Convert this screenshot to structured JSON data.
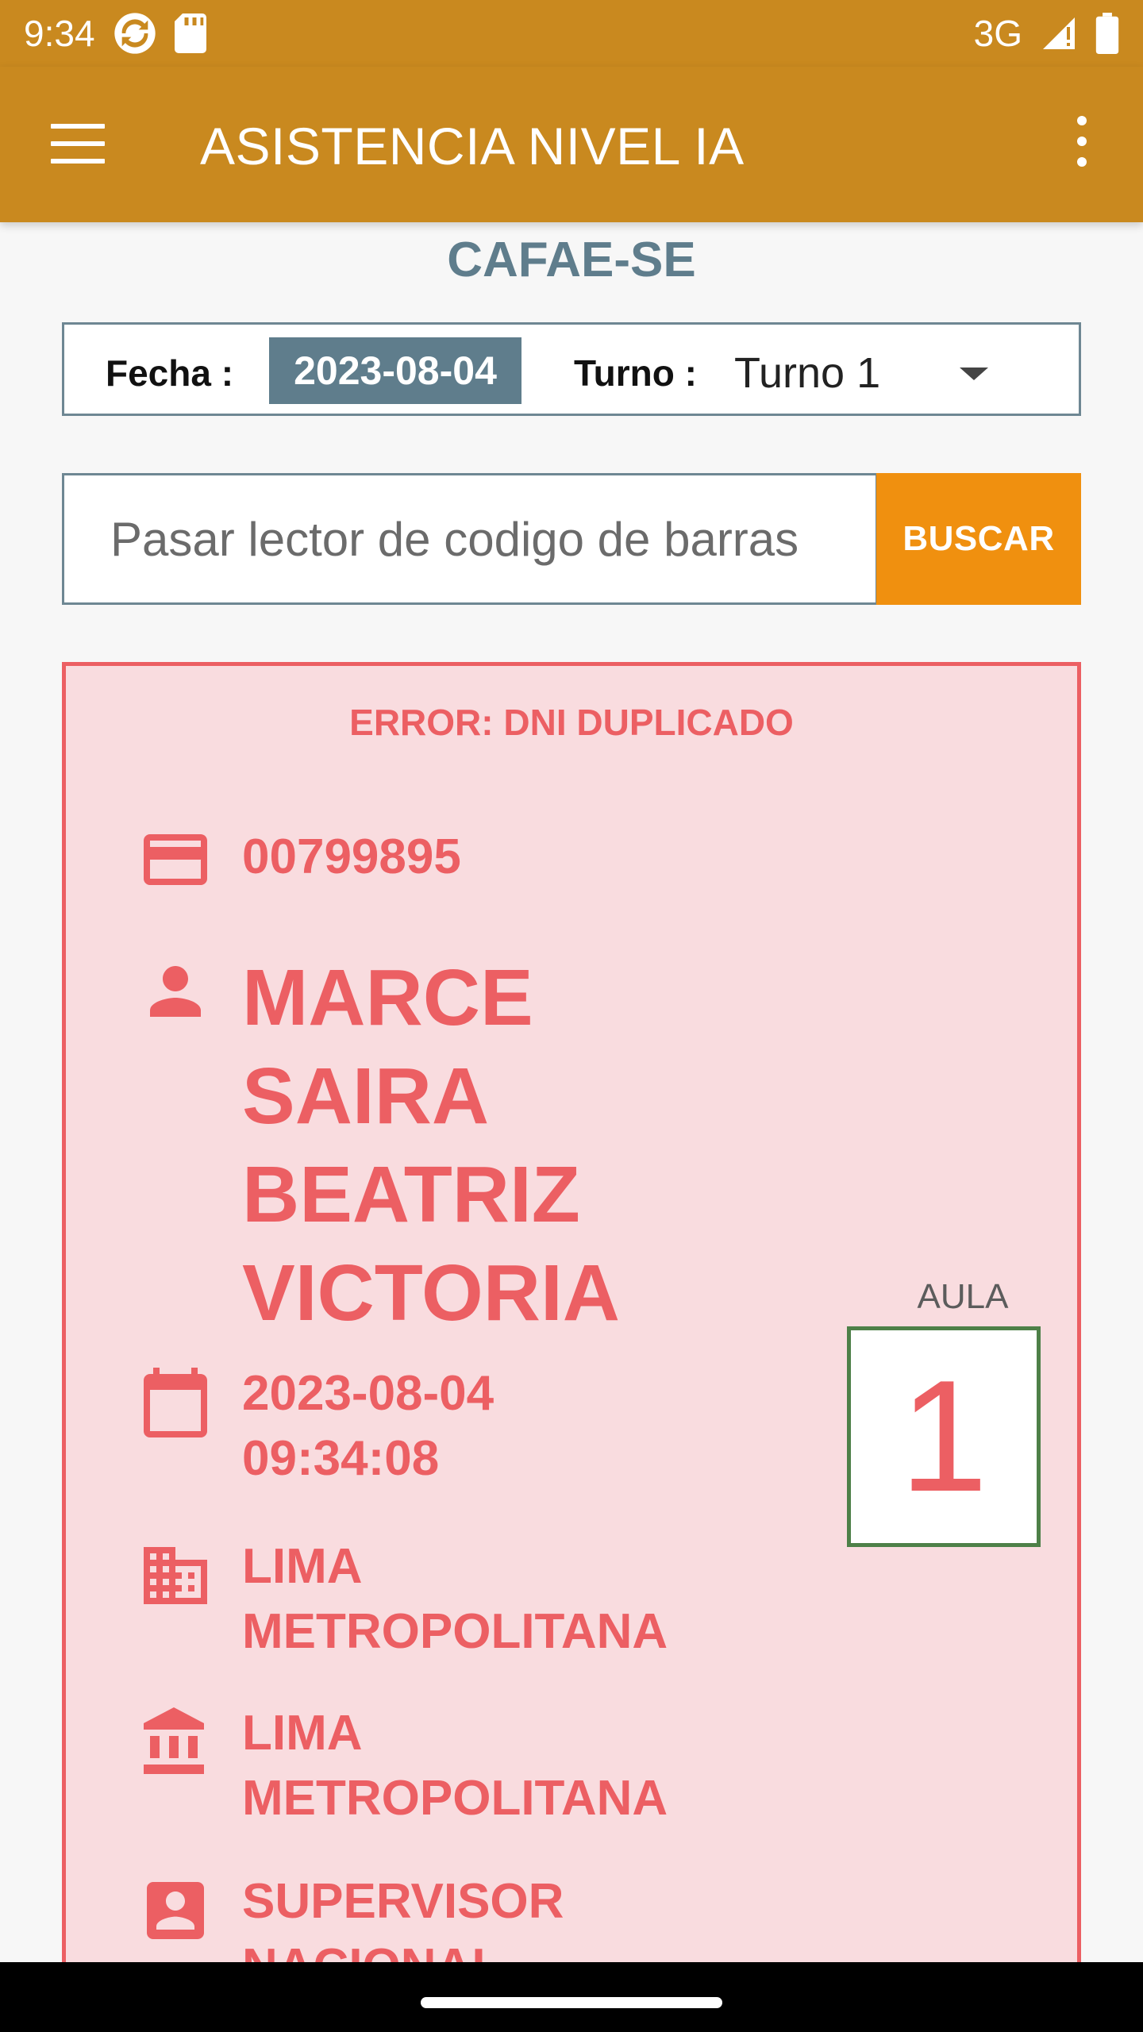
{
  "status": {
    "time": "9:34",
    "network": "3G"
  },
  "appbar": {
    "title": "ASISTENCIA NIVEL IA"
  },
  "org": {
    "name": "CAFAE-SE"
  },
  "filter": {
    "fecha_label": "Fecha :",
    "fecha_value": "2023-08-04",
    "turno_label": "Turno :",
    "turno_value": "Turno 1"
  },
  "search": {
    "placeholder": "Pasar lector de codigo de barras",
    "button_label": "BUSCAR"
  },
  "record": {
    "error": "ERROR: DNI DUPLICADO",
    "dni": "00799895",
    "name_lines": [
      "MARCE",
      "SAIRA",
      "BEATRIZ",
      "VICTORIA"
    ],
    "datetime_lines": [
      "2023-08-04",
      "09:34:08"
    ],
    "region_lines": [
      "LIMA",
      "METROPOLITANA"
    ],
    "institution_lines": [
      "LIMA",
      "METROPOLITANA"
    ],
    "role_lines": [
      "SUPERVISOR",
      "NACIONAL"
    ],
    "aula_label": "AULA",
    "aula_value": "1"
  },
  "colors": {
    "appbar": "#c9891f",
    "accent_button": "#f0900f",
    "error": "#ec5f63",
    "card_bg": "#f9dcdf",
    "slate": "#5f7d8c",
    "aula_border": "#4e8048"
  },
  "icons": {
    "dni": "credit-card-icon",
    "name": "person-icon",
    "datetime": "calendar-icon",
    "region": "city-icon",
    "institution": "bank-icon",
    "role": "badge-icon"
  }
}
